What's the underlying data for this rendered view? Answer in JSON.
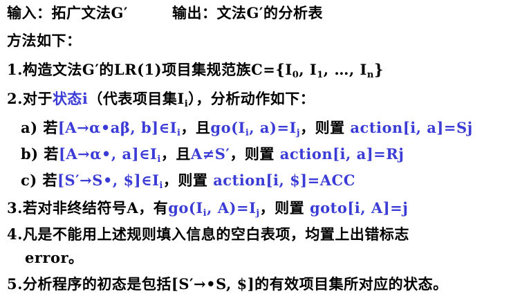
{
  "header": {
    "input_text": "输入：拓广文法G′",
    "output_text": "输出：文法G′的分析表"
  },
  "method_title": "方法如下：",
  "step1": {
    "prefix": "1.构造文法G′的LR(1)项目集规范族C={I",
    "sub0": "0",
    "sep1": ", I",
    "sub1": "1",
    "sep2": ", …, I",
    "subn": "n",
    "suffix": "}"
  },
  "step2": {
    "prefix": "2.对于",
    "state_i": "状态i",
    "mid": "（代表项目集I",
    "sub": "i",
    "suffix": "），分析动作如下："
  },
  "rule_a": {
    "label": "a) 若",
    "item": "[A→α•aβ, b]∈I",
    "item_sub": "i",
    "and": "，且",
    "go_prefix": "go(I",
    "go_sub_i": "i",
    "go_mid": ", a)=I",
    "go_sub_j": "j",
    "then": "，则置 ",
    "action": "action[i, a]=Sj"
  },
  "rule_b": {
    "label": "b) 若",
    "item": "[A→α•, a]∈I",
    "item_sub": "i",
    "and": "，且",
    "cond": "A≠S′",
    "then": "，则置 ",
    "action": "action[i, a]=Rj"
  },
  "rule_c": {
    "label": "c) 若",
    "item": "[S′→S•, $]∈I",
    "item_sub": "i",
    "then": "，则置 ",
    "action": "action[i, $]=ACC"
  },
  "step3": {
    "prefix": "3.若对非终结符号A，有",
    "go_prefix": "go(I",
    "go_sub_i": "i",
    "go_mid": ", A)=I",
    "go_sub_j": "j",
    "then": "，则置 ",
    "goto": "goto[i, A]=j"
  },
  "step4": {
    "line1": "4.凡是不能用上述规则填入信息的空白表项，均置上出错标志",
    "line2": "error。"
  },
  "step5": {
    "text": "5.分析程序的初态是包括[S′→•S, $]的有效项目集所对应的状态。"
  },
  "colors": {
    "text": "#000000",
    "accent_blue": "#3b3bd6"
  }
}
